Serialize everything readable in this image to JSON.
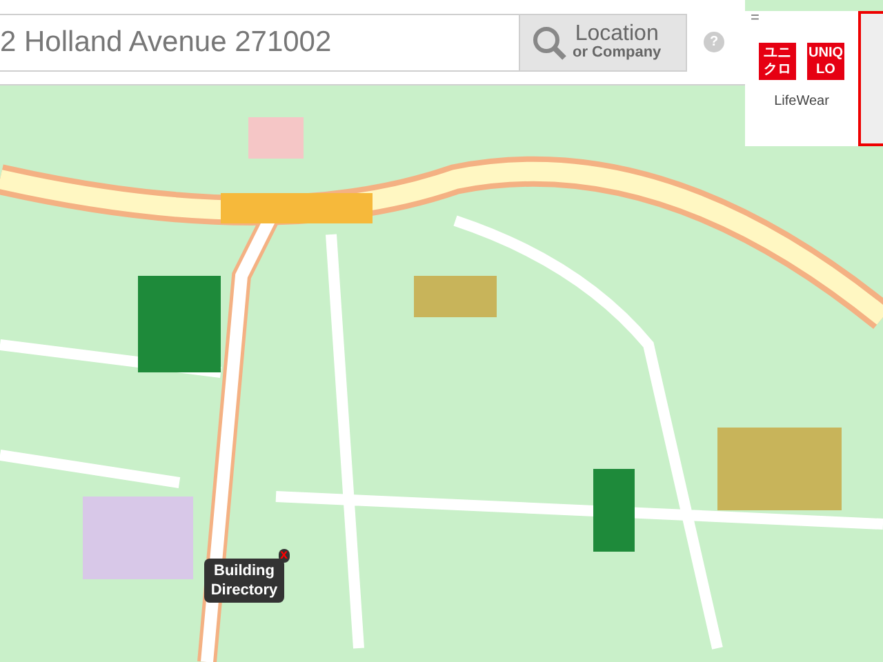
{
  "search": {
    "value": "2 Holland Avenue 271002",
    "button": {
      "title": "Location",
      "subtitle": "or Company"
    }
  },
  "help": {
    "label": "?"
  },
  "ad": {
    "menu": "=",
    "logo_katakana": "ユニクロ",
    "logo_latin": "UNIQLO",
    "tagline": "LifeWear"
  },
  "map": {
    "popup": {
      "label": "Building Directory",
      "close": "x"
    }
  }
}
